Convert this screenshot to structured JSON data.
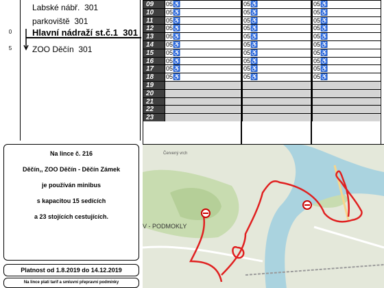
{
  "minutes_column": {
    "values": [
      "0",
      "5"
    ]
  },
  "route_stops": [
    {
      "name": "Labské nábř.",
      "zone": "301"
    },
    {
      "name": "parkoviště",
      "zone": "301"
    },
    {
      "name": "Hlavní nádraží st.č.1",
      "zone": "301",
      "current": true
    },
    {
      "name": "ZOO Děčín",
      "zone": "301"
    }
  ],
  "timetable": {
    "hours": [
      "09",
      "10",
      "11",
      "12",
      "13",
      "14",
      "15",
      "16",
      "17",
      "18",
      "19",
      "20",
      "21",
      "22",
      "23"
    ],
    "columns": [
      {
        "entries": [
          "05♿",
          "05♿",
          "05♿",
          "05♿",
          "05♿",
          "05♿",
          "05♿",
          "05♿",
          "05♿",
          "05♿",
          "",
          "",
          "",
          "",
          ""
        ]
      },
      {
        "entries": [
          "05♿",
          "05♿",
          "05♿",
          "05♿",
          "05♿",
          "05♿",
          "05♿",
          "05♿",
          "05♿",
          "05♿",
          "",
          "",
          "",
          "",
          ""
        ]
      },
      {
        "entries": [
          "05♿",
          "05♿",
          "05♿",
          "05♿",
          "05♿",
          "05♿",
          "05♿",
          "05♿",
          "05♿",
          "05♿",
          "",
          "",
          "",
          "",
          ""
        ]
      }
    ]
  },
  "info_box": {
    "line1": "Na lince č. 216",
    "line2": "Děčín,, ZOO Děčín - Děčín Zámek",
    "line3": "je používán minibus",
    "line4": "s kapacitou 15 sedících",
    "line5": "a 23 stojících cestujících."
  },
  "validity": "Platnost od 1.8.2019 do 14.12.2019",
  "tariff_note": "Na lince platí tarif a smluvní přepravní podmínky",
  "map": {
    "labels": {
      "district": "V - PODMOKLY",
      "street": "Červený vrch"
    },
    "colors": {
      "route": "#e02020",
      "river": "#aad3df",
      "park": "#c8dcb0",
      "land": "#e4e8da"
    }
  }
}
